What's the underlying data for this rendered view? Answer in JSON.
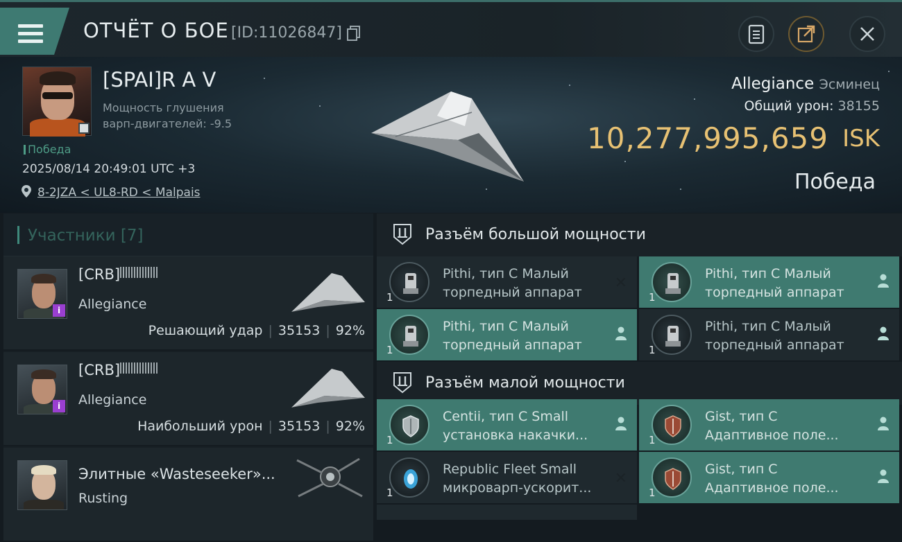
{
  "header": {
    "title": "ОТЧЁТ О БОЕ",
    "report_id": "[ID:11026847]"
  },
  "victim": {
    "name": "[SPAI]R A V",
    "warp_label": "Мощность глушения",
    "warp_value": "варп-двигателей: -9.5",
    "result_tag": "Победа",
    "datetime": "2025/08/14 20:49:01 UTC +3",
    "location": "8-2JZA < UL8-RD < Malpais",
    "ship": "Allegiance",
    "ship_class": "Эсминец",
    "total_damage_label": "Общий урон:",
    "total_damage": "38155",
    "isk_value": "10,277,995,659",
    "isk_currency": "ISK",
    "result_big": "Победа"
  },
  "participants": {
    "title": "Участники [7]",
    "rows": [
      {
        "name": "[CRB]",
        "ship": "Allegiance",
        "role": "Решающий удар",
        "damage": "35153",
        "percent": "92%"
      },
      {
        "name": "[CRB]",
        "ship": "Allegiance",
        "role": "Наибольший урон",
        "damage": "35153",
        "percent": "92%"
      },
      {
        "name": "Элитные «Wasteseeker»...",
        "ship": "Rusting"
      }
    ]
  },
  "modules": {
    "high_title": "Разъём большой мощности",
    "low_title": "Разъём малой мощности",
    "high": [
      {
        "qty": "1",
        "line1": "Pithi, тип С Малый",
        "line2": "торпедный аппарат",
        "mark": "✕"
      },
      {
        "qty": "1",
        "line1": "Pithi, тип С Малый",
        "line2": "торпедный аппарат",
        "mark": "person"
      },
      {
        "qty": "1",
        "line1": "Pithi, тип С Малый",
        "line2": "торпедный аппарат",
        "mark": "person"
      },
      {
        "qty": "1",
        "line1": "Pithi, тип С Малый",
        "line2": "торпедный аппарат",
        "mark": "person"
      }
    ],
    "low": [
      {
        "qty": "1",
        "line1": "Centii, тип С Small",
        "line2": "установка накачки...",
        "mark": "person"
      },
      {
        "qty": "1",
        "line1": "Gist, тип С",
        "line2": "Адаптивное поле...",
        "mark": "person"
      },
      {
        "qty": "1",
        "line1": "Republic Fleet Small",
        "line2": "микроварп-ускорит...",
        "mark": "✕"
      },
      {
        "qty": "1",
        "line1": "Gist, тип С",
        "line2": "Адаптивное поле...",
        "mark": "person"
      }
    ]
  },
  "colors": {
    "accent": "#3f7a70",
    "isk": "#e7c173",
    "victory": "#4e9c86",
    "bg": "#141b20"
  }
}
